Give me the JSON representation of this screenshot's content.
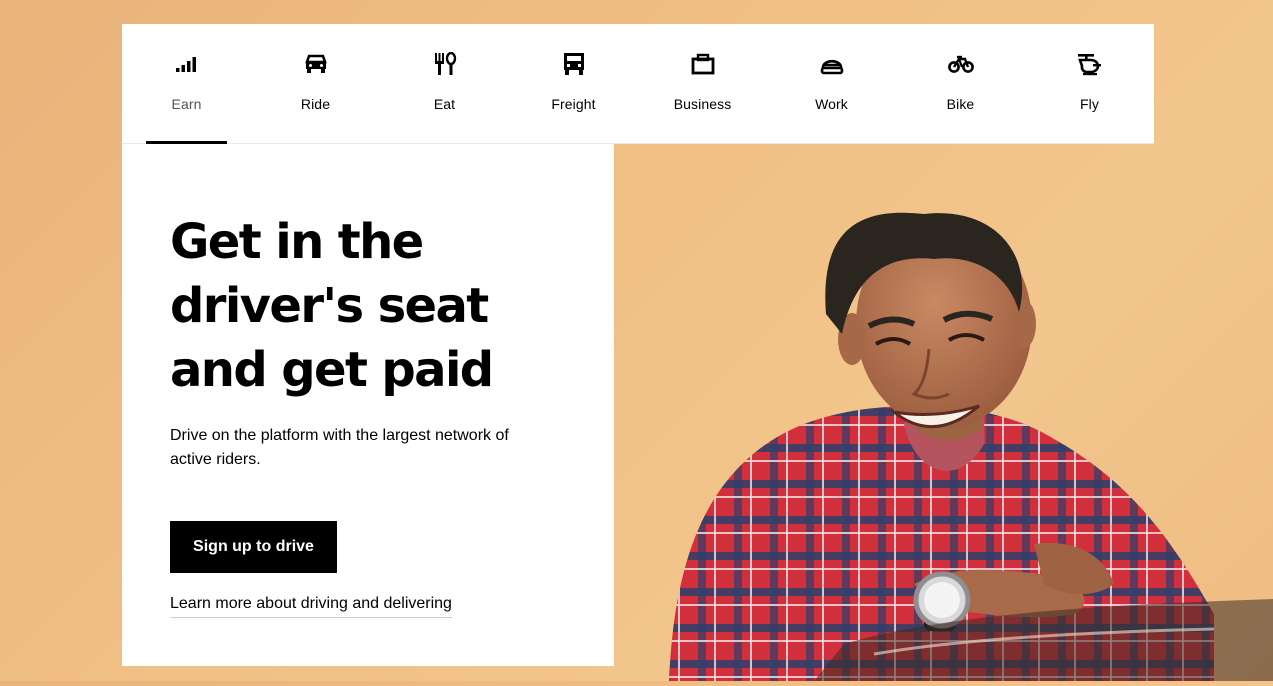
{
  "nav": {
    "tabs": [
      {
        "label": "Earn",
        "icon": "earn-bars-icon",
        "active": true
      },
      {
        "label": "Ride",
        "icon": "car-icon",
        "active": false
      },
      {
        "label": "Eat",
        "icon": "fork-knife-icon",
        "active": false
      },
      {
        "label": "Freight",
        "icon": "truck-icon",
        "active": false
      },
      {
        "label": "Business",
        "icon": "briefcase-icon",
        "active": false
      },
      {
        "label": "Work",
        "icon": "hardhat-icon",
        "active": false
      },
      {
        "label": "Bike",
        "icon": "bicycle-icon",
        "active": false
      },
      {
        "label": "Fly",
        "icon": "helicopter-icon",
        "active": false
      }
    ]
  },
  "hero": {
    "title": "Get in the driver's seat and get paid",
    "subtitle": "Drive on the platform with the largest network of active riders.",
    "cta_label": "Sign up to drive",
    "link_label": "Learn more about driving and delivering"
  },
  "colors": {
    "background": "#F0BF83",
    "shirt_red": "#D22F3C",
    "shirt_blue": "#2D3F6B",
    "text": "#000000",
    "tab_active_text": "#545454"
  }
}
